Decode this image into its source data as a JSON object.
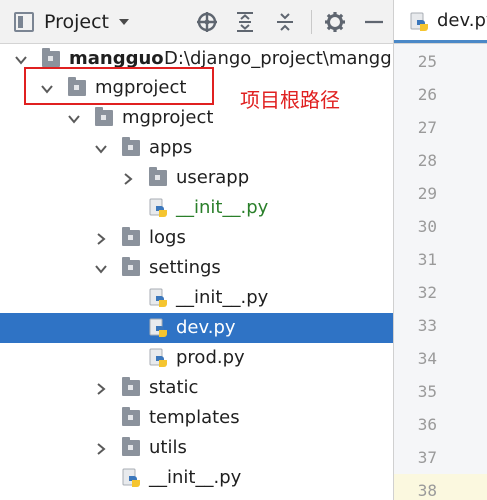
{
  "project_panel": {
    "title": "Project"
  },
  "tree": {
    "rows": [
      {
        "label": "mangguo",
        "hint": "D:\\django_project\\mangguo",
        "type": "root",
        "expanded": true
      },
      {
        "label": "mgproject",
        "type": "folder",
        "expanded": true
      },
      {
        "label": "mgproject",
        "type": "folder",
        "expanded": true
      },
      {
        "label": "apps",
        "type": "folder",
        "expanded": true
      },
      {
        "label": "userapp",
        "type": "folder",
        "expanded": false
      },
      {
        "label": "__init__.py",
        "type": "python",
        "style": "green"
      },
      {
        "label": "logs",
        "type": "folder",
        "expanded": false
      },
      {
        "label": "settings",
        "type": "folder",
        "expanded": true
      },
      {
        "label": "__init__.py",
        "type": "python"
      },
      {
        "label": "dev.py",
        "type": "python",
        "selected": true
      },
      {
        "label": "prod.py",
        "type": "python"
      },
      {
        "label": "static",
        "type": "folder",
        "expanded": false
      },
      {
        "label": "templates",
        "type": "folder"
      },
      {
        "label": "utils",
        "type": "folder",
        "expanded": false
      },
      {
        "label": "__init__.py",
        "type": "python"
      }
    ]
  },
  "annotation": {
    "text": "项目根路径",
    "color": "#e02020"
  },
  "editor": {
    "tab_label": "dev.py",
    "line_numbers": [
      "25",
      "26",
      "27",
      "28",
      "29",
      "30",
      "31",
      "32",
      "33",
      "34",
      "35",
      "36",
      "37",
      "38"
    ]
  },
  "colors": {
    "selection": "#2f73c5",
    "folder": "#8b929c",
    "python_blue": "#3b77bc",
    "python_yellow": "#f5c530",
    "green_file": "#2a7f2a"
  }
}
